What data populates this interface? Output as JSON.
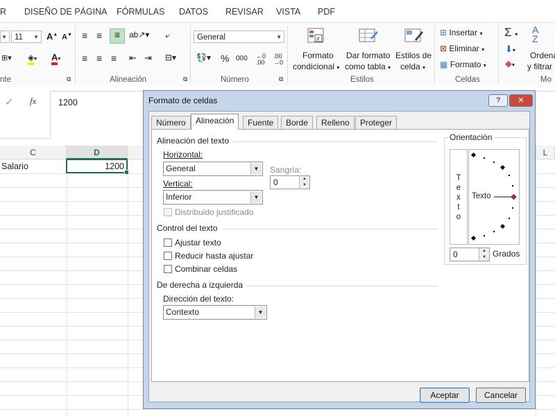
{
  "menu": [
    "R",
    "DISEÑO DE PÁGINA",
    "FÓRMULAS",
    "DATOS",
    "REVISAR",
    "VISTA",
    "PDF"
  ],
  "ribbon": {
    "font_size": "11",
    "number_format": "General",
    "font_group_label": "nte",
    "alignment_label": "Alineación",
    "number_label": "Número",
    "styles_label": "Estilos",
    "cells_label": "Celdas",
    "editing_label": "Mo",
    "percent": "%",
    "thousands": "000",
    "cond_format": {
      "l1": "Formato",
      "l2": "condicional"
    },
    "format_table": {
      "l1": "Dar formato",
      "l2": "como tabla"
    },
    "cell_styles": {
      "l1": "Estilos de",
      "l2": "celda"
    },
    "insert": "Insertar",
    "delete": "Eliminar",
    "format": "Formato",
    "order": {
      "l1": "Ordena",
      "l2": "y filtrar"
    }
  },
  "formula": {
    "value": "1200",
    "fx": "fx",
    "check": "✓"
  },
  "grid": {
    "col_c": "C",
    "col_d": "D",
    "col_l": "L",
    "cell_c1": "Salario",
    "cell_d1": "1200"
  },
  "dialog": {
    "title": "Formato de celdas",
    "help": "?",
    "close": "✕",
    "tabs": [
      "Número",
      "Alineación",
      "Fuente",
      "Borde",
      "Relleno",
      "Proteger"
    ],
    "text_alignment": "Alineación del texto",
    "horizontal_label": "Horizontal:",
    "horizontal_value": "General",
    "vertical_label": "Vertical:",
    "vertical_value": "Inferior",
    "indent_label": "Sangría:",
    "indent_value": "0",
    "justify_distributed": "Distribuido justificado",
    "text_control": "Control del texto",
    "wrap_text": "Ajustar texto",
    "shrink_to_fit": "Reducir hasta ajustar",
    "merge_cells": "Combinar celdas",
    "rtl": "De derecha a izquierda",
    "text_direction_label": "Dirección del texto:",
    "text_direction_value": "Contexto",
    "orientation": "Orientación",
    "vertical_text": [
      "T",
      "e",
      "x",
      "t",
      "o"
    ],
    "orientation_text": "Texto",
    "degrees_value": "0",
    "degrees_label": "Grados",
    "ok": "Aceptar",
    "cancel": "Cancelar"
  }
}
